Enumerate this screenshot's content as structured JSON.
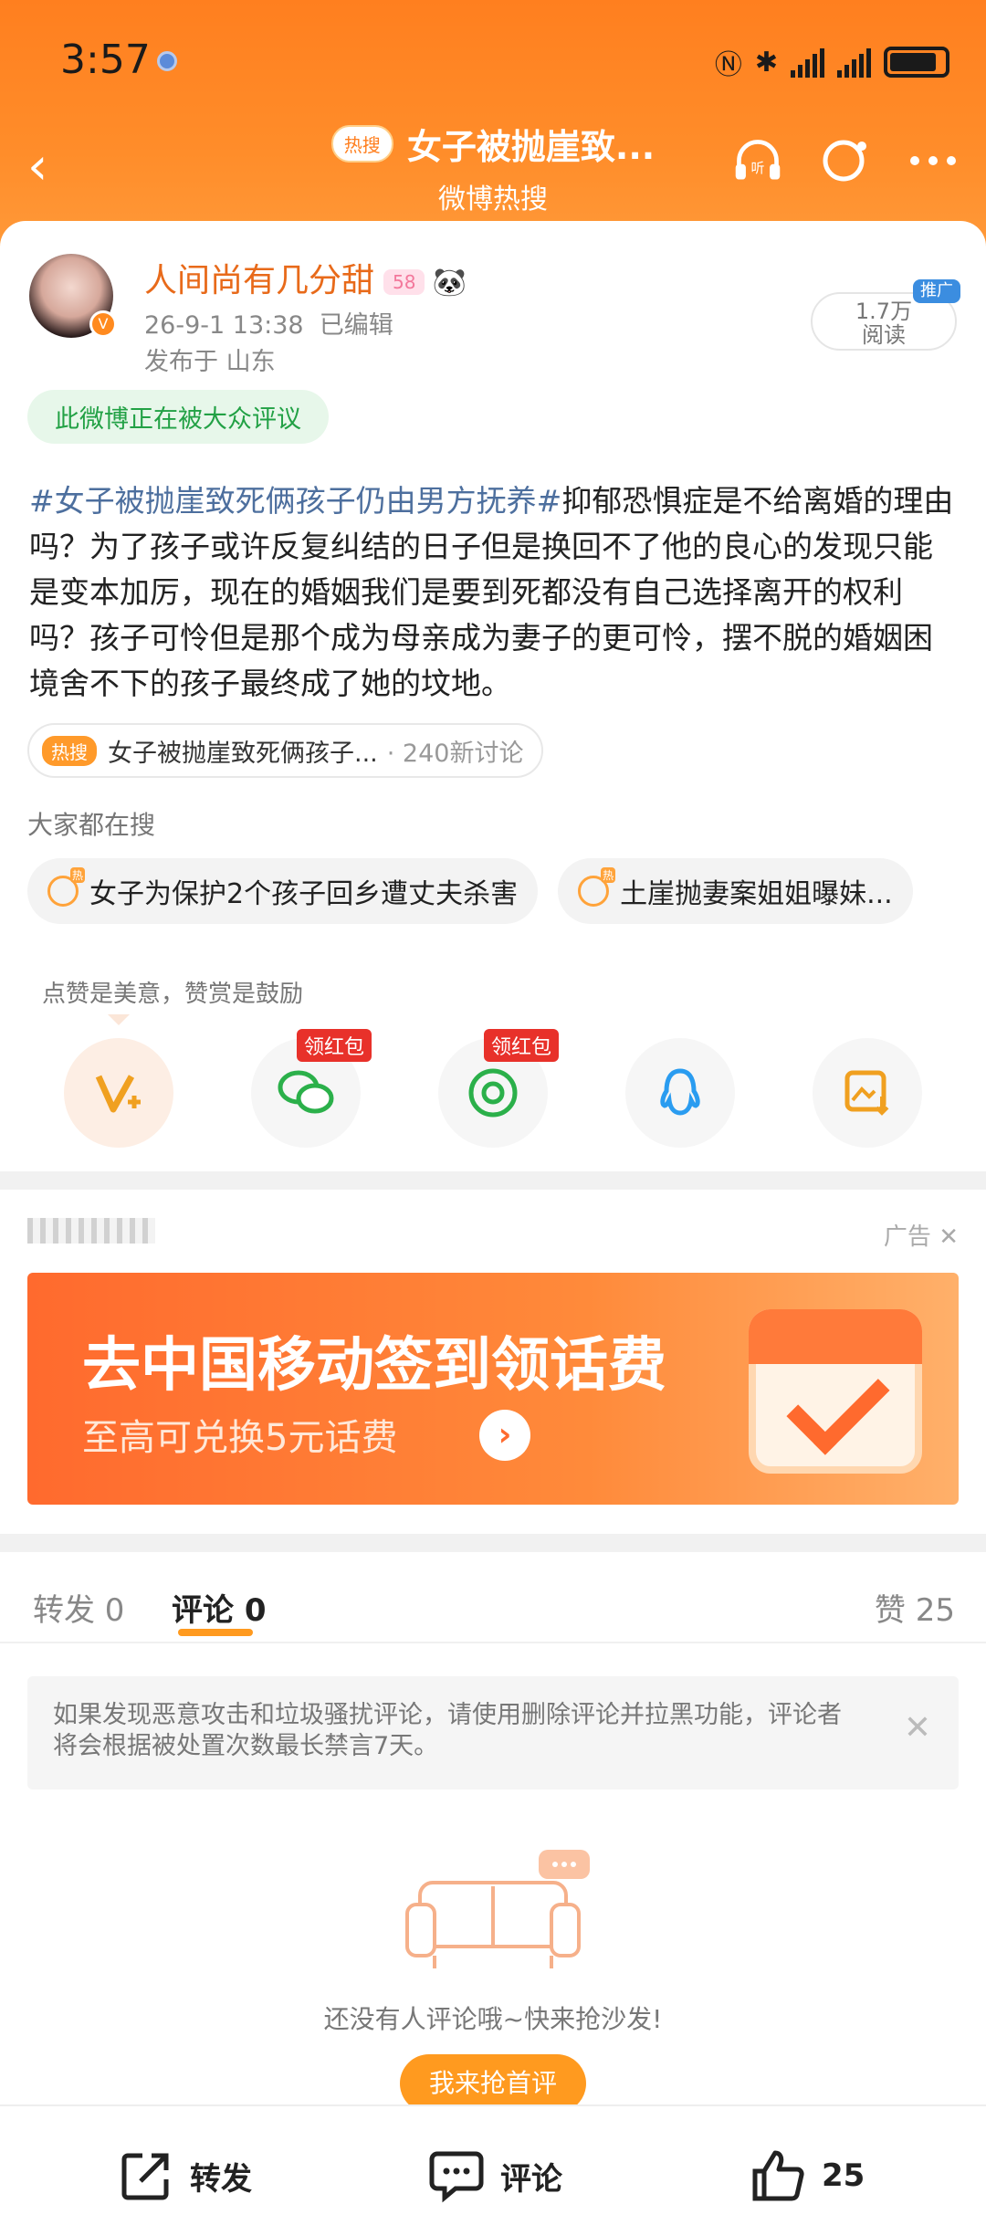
{
  "status_bar": {
    "time": "3:57"
  },
  "nav": {
    "hot_tag": "热搜",
    "title": "女子被抛崖致...",
    "subtitle": "微博热搜",
    "listen_icon": "listen-icon",
    "refresh_icon": "refresh-icon",
    "more_icon": "more-icon"
  },
  "post": {
    "username": "人间尚有几分甜",
    "level": "58",
    "datetime": "26-9-1 13:38",
    "edited": "已编辑",
    "location": "发布于 山东",
    "reads_value": "1.7万",
    "reads_label": "阅读",
    "promo_tag": "推广",
    "public_notice": "此微博正在被大众评议",
    "topic": "#女子被抛崖致死俩孩子仍由男方抚养#",
    "body": "抑郁恐惧症是不给离婚的理由吗？为了孩子或许反复纠结的日子但是换回不了他的良心的发现只能是变本加厉，现在的婚姻我们是要到死都没有自己选择离开的权利吗？孩子可怜但是那个成为母亲成为妻子的更可怜，摆不脱的婚姻困境舍不下的孩子最终成了她的坟地。",
    "hot_row": {
      "tag": "热搜",
      "text": "女子被抛崖致死俩孩子...",
      "count": "· 240新讨论"
    }
  },
  "search": {
    "label": "大家都在搜",
    "chips": [
      "女子为保护2个孩子回乡遭丈夫杀害",
      "土崖抛妻案姐姐曝妹..."
    ]
  },
  "actions": {
    "tip": "点赞是美意，赞赏是鼓励",
    "red_packet": "领红包"
  },
  "ad": {
    "label": "广告",
    "title": "去中国移动签到领话费",
    "subtitle": "至高可兑换5元话费"
  },
  "tabs": {
    "repost": "转发 0",
    "comment": "评论 0",
    "like": "赞 25"
  },
  "notice": "如果发现恶意攻击和垃圾骚扰评论，请使用删除评论并拉黑功能，评论者将会根据被处置次数最长禁言7天。",
  "empty": {
    "text": "还没有人评论哦~快来抢沙发!",
    "button": "我来抢首评"
  },
  "bottom": {
    "repost": "转发",
    "comment": "评论",
    "like": "25"
  },
  "colors": {
    "brand_orange": "#ff8a1f",
    "topic_blue": "#4d6f9e",
    "green": "#22a145"
  }
}
